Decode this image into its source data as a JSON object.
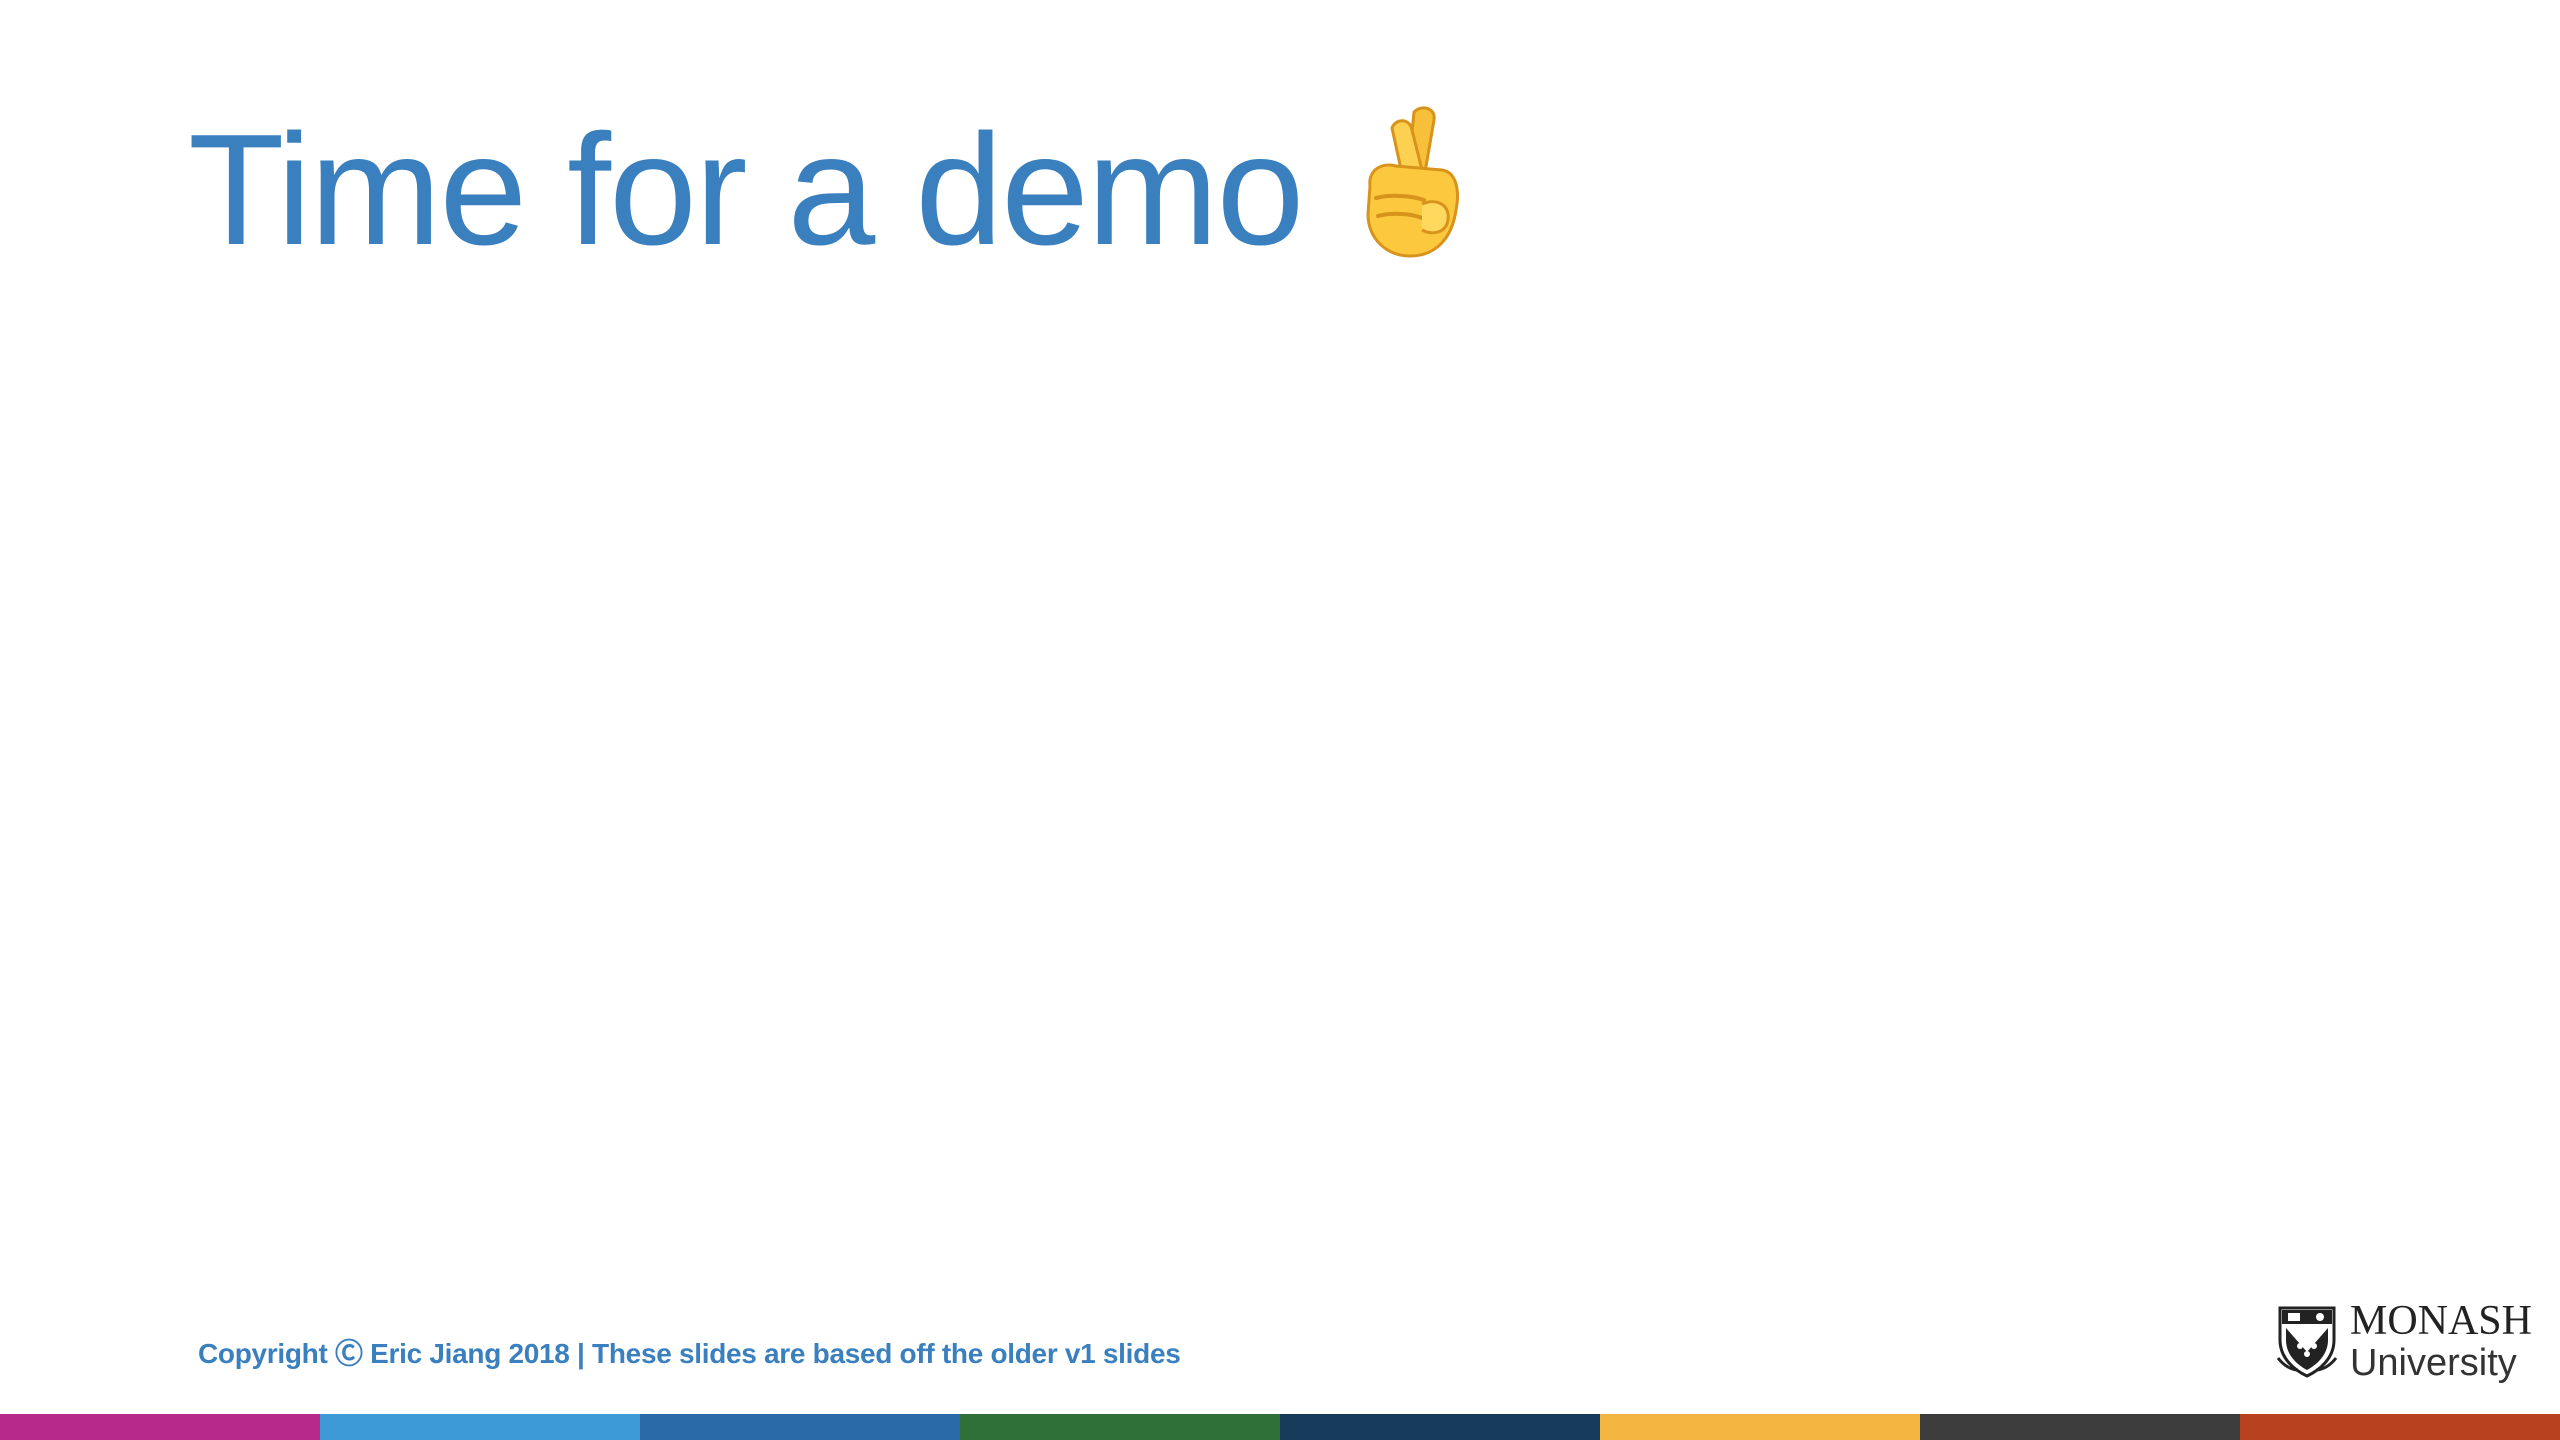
{
  "slide": {
    "title": "Time for a demo",
    "title_emoji": "crossed-fingers-icon",
    "footer": "Copyright Ⓒ Eric Jiang 2018 | These slides are based off the older v1 slides",
    "logo": {
      "line1": "MONASH",
      "line2": "University"
    }
  },
  "colors": {
    "accent": "#3a7fbe",
    "stripe": [
      "#b72a8c",
      "#3e9ad6",
      "#2a6aa8",
      "#2f6f38",
      "#163a5a",
      "#f2b640",
      "#3c3c3c",
      "#b8421f"
    ]
  }
}
